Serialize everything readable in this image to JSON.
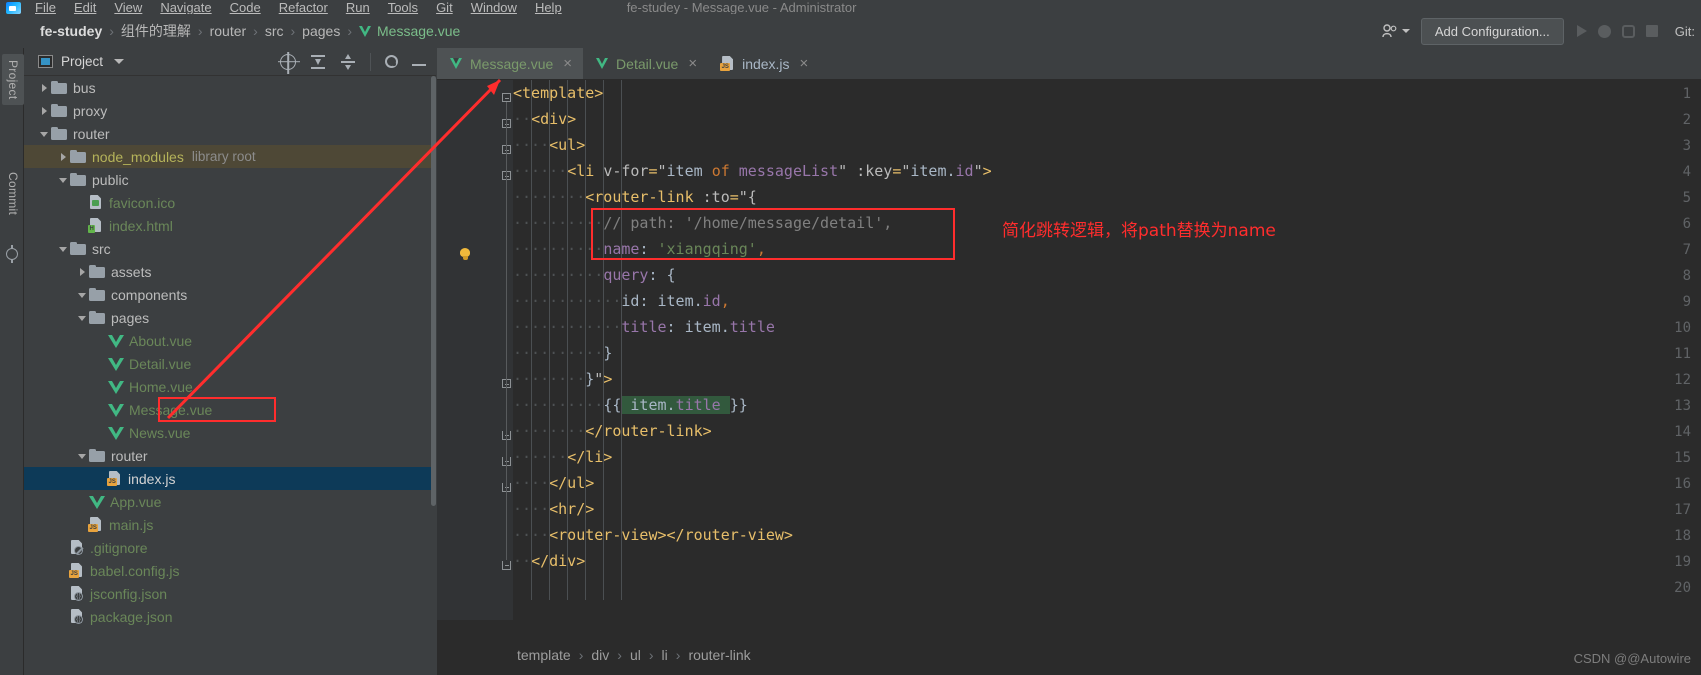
{
  "window": {
    "title": "fe-studey - Message.vue - Administrator",
    "menu": [
      "File",
      "Edit",
      "View",
      "Navigate",
      "Code",
      "Refactor",
      "Run",
      "Tools",
      "Git",
      "Window",
      "Help"
    ]
  },
  "navbar": {
    "breadcrumb": [
      {
        "label": "fe-studey",
        "type": "root"
      },
      {
        "label": "组件的理解",
        "type": "dir"
      },
      {
        "label": "router",
        "type": "dir"
      },
      {
        "label": "src",
        "type": "dir"
      },
      {
        "label": "pages",
        "type": "dir"
      },
      {
        "label": "Message.vue",
        "type": "vue-file"
      }
    ],
    "separator": "›",
    "add_configuration_label": "Add Configuration...",
    "git_label": "Git:",
    "people_icon": "people-icon",
    "run_icon": "run-icon",
    "debug_icon": "debug-icon",
    "coverage_icon": "coverage-icon",
    "stop_icon": "stop-icon"
  },
  "left_strip": {
    "project_tab": "Project",
    "commit_tab": "Commit",
    "structure_icon": "structure-icon"
  },
  "project_panel": {
    "title": "Project",
    "icons": [
      "select-opened-file-icon",
      "expand-all-icon",
      "collapse-all-icon",
      "gear-icon",
      "hide-icon"
    ],
    "tree": [
      {
        "indent": 1,
        "arrow": "right",
        "icon": "folder",
        "label": "bus",
        "style": "plain"
      },
      {
        "indent": 1,
        "arrow": "right",
        "icon": "folder",
        "label": "proxy",
        "style": "plain"
      },
      {
        "indent": 1,
        "arrow": "down",
        "icon": "folder",
        "label": "router",
        "style": "plain"
      },
      {
        "indent": 2,
        "arrow": "right",
        "icon": "folder",
        "label": "node_modules",
        "sub": "library root",
        "style": "olive",
        "row": "highlight-lib"
      },
      {
        "indent": 2,
        "arrow": "down",
        "icon": "folder",
        "label": "public",
        "style": "plain"
      },
      {
        "indent": 3,
        "arrow": "none",
        "icon": "file-image",
        "label": "favicon.ico",
        "style": "green"
      },
      {
        "indent": 3,
        "arrow": "none",
        "icon": "file-html",
        "label": "index.html",
        "style": "green"
      },
      {
        "indent": 2,
        "arrow": "down",
        "icon": "folder",
        "label": "src",
        "style": "plain"
      },
      {
        "indent": 3,
        "arrow": "right",
        "icon": "folder",
        "label": "assets",
        "style": "plain"
      },
      {
        "indent": 3,
        "arrow": "down",
        "icon": "folder",
        "label": "components",
        "style": "plain"
      },
      {
        "indent": 3,
        "arrow": "down",
        "icon": "folder",
        "label": "pages",
        "style": "plain"
      },
      {
        "indent": 4,
        "arrow": "none",
        "icon": "vue",
        "label": "About.vue",
        "style": "green"
      },
      {
        "indent": 4,
        "arrow": "none",
        "icon": "vue",
        "label": "Detail.vue",
        "style": "green"
      },
      {
        "indent": 4,
        "arrow": "none",
        "icon": "vue",
        "label": "Home.vue",
        "style": "green"
      },
      {
        "indent": 4,
        "arrow": "none",
        "icon": "vue",
        "label": "Message.vue",
        "style": "green",
        "annotated": true
      },
      {
        "indent": 4,
        "arrow": "none",
        "icon": "vue",
        "label": "News.vue",
        "style": "green"
      },
      {
        "indent": 3,
        "arrow": "down",
        "icon": "folder",
        "label": "router",
        "style": "plain"
      },
      {
        "indent": 4,
        "arrow": "none",
        "icon": "file-js",
        "label": "index.js",
        "style": "white",
        "row": "selected"
      },
      {
        "indent": 3,
        "arrow": "none",
        "icon": "vue",
        "label": "App.vue",
        "style": "green"
      },
      {
        "indent": 3,
        "arrow": "none",
        "icon": "file-js",
        "label": "main.js",
        "style": "green"
      },
      {
        "indent": 2,
        "arrow": "none",
        "icon": "file-ignore",
        "label": ".gitignore",
        "style": "green"
      },
      {
        "indent": 2,
        "arrow": "none",
        "icon": "file-js",
        "label": "babel.config.js",
        "style": "green"
      },
      {
        "indent": 2,
        "arrow": "none",
        "icon": "file-json",
        "label": "jsconfig.json",
        "style": "green"
      },
      {
        "indent": 2,
        "arrow": "none",
        "icon": "file-json",
        "label": "package.json",
        "style": "green"
      }
    ]
  },
  "editor": {
    "tabs": [
      {
        "label": "Message.vue",
        "icon": "vue-icon",
        "active": true,
        "close": "×"
      },
      {
        "label": "Detail.vue",
        "icon": "vue-icon",
        "active": false,
        "close": "×"
      },
      {
        "label": "index.js",
        "icon": "js-icon",
        "active": false,
        "close": "×"
      }
    ],
    "lines": [
      {
        "n": "1",
        "fold": "open"
      },
      {
        "n": "2",
        "fold": "open"
      },
      {
        "n": "3",
        "fold": "open"
      },
      {
        "n": "4",
        "fold": "open"
      },
      {
        "n": "5",
        "fold": "none"
      },
      {
        "n": "6",
        "fold": "none"
      },
      {
        "n": "7",
        "fold": "none",
        "bulb": true
      },
      {
        "n": "8",
        "fold": "none"
      },
      {
        "n": "9",
        "fold": "none"
      },
      {
        "n": "10",
        "fold": "none"
      },
      {
        "n": "11",
        "fold": "none"
      },
      {
        "n": "12",
        "fold": "open"
      },
      {
        "n": "13",
        "fold": "none"
      },
      {
        "n": "14",
        "fold": "close"
      },
      {
        "n": "15",
        "fold": "close"
      },
      {
        "n": "16",
        "fold": "close"
      },
      {
        "n": "17",
        "fold": "none"
      },
      {
        "n": "18",
        "fold": "none"
      },
      {
        "n": "19",
        "fold": "close"
      },
      {
        "n": "20",
        "fold": "none"
      }
    ],
    "code_text": {
      "l1": "<template>",
      "l2": "  <div>",
      "l3": "    <ul>",
      "l4": "      <li v-for=\"item of messageList\" :key=\"item.id\">",
      "l5": "        <router-link :to=\"{",
      "l6": "          // path: '/home/message/detail',",
      "l7": "          name: 'xiangqing',",
      "l8": "          query: {",
      "l9": "            id: item.id,",
      "l10": "            title: item.title",
      "l11": "          }",
      "l12": "        }\">",
      "l13": "          {{ item.title }}",
      "l14": "        </router-link>",
      "l15": "      </li>",
      "l16": "    </ul>",
      "l17": "    <hr/>",
      "l18": "    <router-view></router-view>",
      "l19": "  </div>",
      "l20": ""
    },
    "breadcrumb": [
      "template",
      "div",
      "ul",
      "li",
      "router-link"
    ],
    "breadcrumb_sep": "›"
  },
  "annotations": {
    "note_text": "简化跳转逻辑，将path替换为name",
    "note_color": "#ff2d2d",
    "arrow_color": "#ff2d2d",
    "highlight_file": "Message.vue"
  },
  "watermark": "CSDN @@Autowire"
}
